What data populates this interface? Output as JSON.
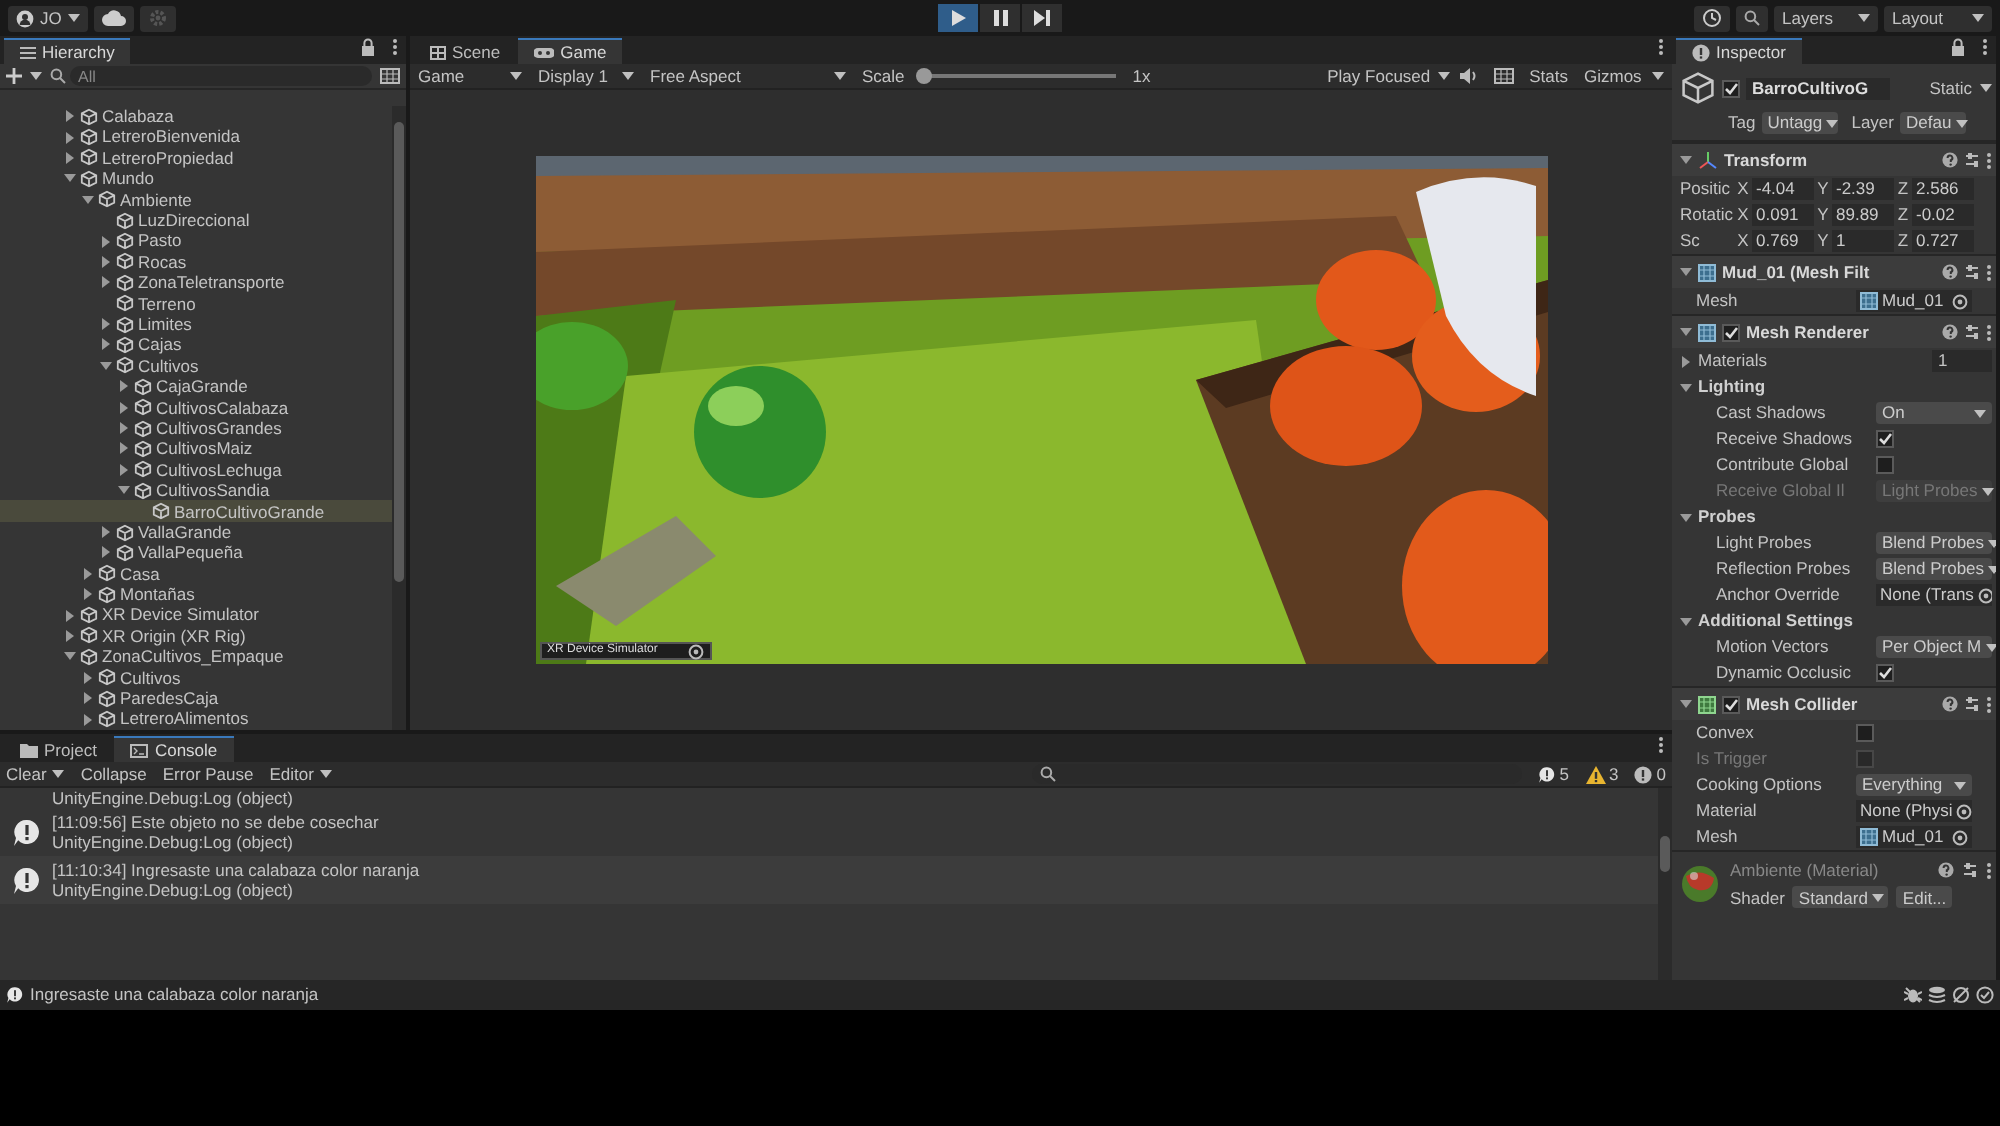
{
  "toolbar": {
    "account": "JO",
    "playing": true,
    "layers": "Layers",
    "layout": "Layout"
  },
  "hierarchy": {
    "title": "Hierarchy",
    "search": {
      "placeholder": "All"
    },
    "items": [
      {
        "label": "Calabaza",
        "expanded": false,
        "selected": false
      },
      {
        "label": "LetreroBienvenida",
        "expanded": false,
        "selected": false
      },
      {
        "label": "LetreroPropiedad",
        "expanded": false,
        "selected": false
      },
      {
        "label": "Mundo",
        "expanded": true,
        "selected": false,
        "children": [
          {
            "label": "Ambiente",
            "expanded": true,
            "selected": false,
            "children": [
              {
                "label": "LuzDireccional",
                "selected": false
              },
              {
                "label": "Pasto",
                "expanded": false,
                "selected": false
              },
              {
                "label": "Rocas",
                "expanded": false,
                "selected": false
              },
              {
                "label": "ZonaTeletransporte",
                "expanded": false,
                "selected": false
              },
              {
                "label": "Terreno",
                "selected": false
              },
              {
                "label": "Limites",
                "expanded": false,
                "selected": false
              },
              {
                "label": "Cajas",
                "expanded": false,
                "selected": false
              },
              {
                "label": "Cultivos",
                "expanded": true,
                "selected": false,
                "children": [
                  {
                    "label": "CajaGrande",
                    "expanded": false,
                    "selected": false
                  },
                  {
                    "label": "CultivosCalabaza",
                    "expanded": false,
                    "selected": false
                  },
                  {
                    "label": "CultivosGrandes",
                    "expanded": false,
                    "selected": false
                  },
                  {
                    "label": "CultivosMaiz",
                    "expanded": false,
                    "selected": false
                  },
                  {
                    "label": "CultivosLechuga",
                    "expanded": false,
                    "selected": false
                  },
                  {
                    "label": "CultivosSandia",
                    "expanded": true,
                    "selected": false,
                    "children": [
                      {
                        "label": "BarroCultivoGrande",
                        "selected": true
                      }
                    ]
                  }
                ]
              },
              {
                "label": "VallaGrande",
                "expanded": false,
                "selected": false
              },
              {
                "label": "VallaPequeña",
                "expanded": false,
                "selected": false
              }
            ]
          },
          {
            "label": "Casa",
            "expanded": false,
            "selected": false
          },
          {
            "label": "Montañas",
            "expanded": false,
            "selected": false
          }
        ]
      },
      {
        "label": "XR Device Simulator",
        "expanded": false,
        "selected": false
      },
      {
        "label": "XR Origin (XR Rig)",
        "expanded": false,
        "selected": false
      },
      {
        "label": "ZonaCultivos_Empaque",
        "expanded": true,
        "selected": false,
        "children": [
          {
            "label": "Cultivos",
            "expanded": false,
            "selected": false
          },
          {
            "label": "ParedesCaja",
            "expanded": false,
            "selected": false
          },
          {
            "label": "LetreroAlimentos",
            "expanded": false,
            "selected": false
          }
        ]
      }
    ]
  },
  "game_view": {
    "tabs": [
      {
        "label": "Scene",
        "kind": "scene",
        "selected": false
      },
      {
        "label": "Game",
        "kind": "game",
        "selected": true
      }
    ],
    "toolbar": {
      "mode": "Game",
      "display": "Display 1",
      "aspect": "Free Aspect",
      "scale_label": "Scale",
      "scale": {
        "level": 0
      },
      "scale_value": "1x",
      "play_mode": "Play Focused",
      "stats": "Stats",
      "gizmos": "Gizmos"
    },
    "overlay": "XR Device Simulator"
  },
  "inspector": {
    "title": "Inspector",
    "object": {
      "name": "BarroCultivoG",
      "active": true,
      "static": "Static",
      "tag_label": "Tag",
      "tag": "Untagg",
      "layer_label": "Layer",
      "layer": "Defau"
    },
    "components": [
      {
        "kind": "transform",
        "title": "Transform",
        "rows": [
          {
            "kind": "vector",
            "label": "Positic",
            "values": [
              {
                "axis": "X",
                "value": "-4.04"
              },
              {
                "axis": "Y",
                "value": "-2.39"
              },
              {
                "axis": "Z",
                "value": "2.586"
              }
            ]
          },
          {
            "kind": "vector",
            "label": "Rotatic",
            "values": [
              {
                "axis": "X",
                "value": "0.091"
              },
              {
                "axis": "Y",
                "value": "89.89"
              },
              {
                "axis": "Z",
                "value": "-0.02"
              }
            ]
          },
          {
            "kind": "vector",
            "label": "Sc",
            "values": [
              {
                "axis": "X",
                "value": "0.769"
              },
              {
                "axis": "Y",
                "value": "1"
              },
              {
                "axis": "Z",
                "value": "0.727"
              }
            ]
          }
        ]
      },
      {
        "kind": "mesh",
        "title": "Mud_01 (Mesh Filt",
        "rows": [
          {
            "kind": "mesh",
            "label": "Mesh",
            "value": "Mud_01",
            "disabled": false
          }
        ]
      },
      {
        "kind": "mesh",
        "title": "Mesh Renderer",
        "enabled": true,
        "rows": [
          {
            "kind": "count",
            "label": "Materials",
            "value": "1",
            "disabled": false
          },
          {
            "kind": "section",
            "label": "Lighting",
            "expanded": true,
            "children": [
              {
                "kind": "dropdown",
                "label": "Cast Shadows",
                "value": "On",
                "disabled": false
              },
              {
                "kind": "check",
                "label": "Receive Shadows",
                "checked": true,
                "disabled": false
              },
              {
                "kind": "check",
                "label": "Contribute Global",
                "checked": false,
                "disabled": false
              },
              {
                "kind": "dropdown",
                "label": "Receive Global Il",
                "value": "Light Probes",
                "disabled": true
              }
            ]
          },
          {
            "kind": "section",
            "label": "Probes",
            "expanded": true,
            "children": [
              {
                "kind": "dropdown",
                "label": "Light Probes",
                "value": "Blend Probes",
                "disabled": false
              },
              {
                "kind": "dropdown",
                "label": "Reflection Probes",
                "value": "Blend Probes",
                "disabled": false
              },
              {
                "kind": "object",
                "label": "Anchor Override",
                "value": "None (Trans",
                "disabled": false
              }
            ]
          },
          {
            "kind": "section",
            "label": "Additional Settings",
            "expanded": true,
            "children": [
              {
                "kind": "dropdown",
                "label": "Motion Vectors",
                "value": "Per Object M",
                "disabled": false
              },
              {
                "kind": "check",
                "label": "Dynamic Occlusic",
                "checked": true,
                "disabled": false
              }
            ]
          }
        ]
      },
      {
        "kind": "collider",
        "title": "Mesh Collider",
        "enabled": true,
        "rows": [
          {
            "kind": "check",
            "label": "Convex",
            "checked": false,
            "disabled": false
          },
          {
            "kind": "check",
            "label": "Is Trigger",
            "checked": false,
            "disabled": true
          },
          {
            "kind": "dropdown",
            "label": "Cooking Options",
            "value": "Everything",
            "disabled": false
          },
          {
            "kind": "object",
            "label": "Material",
            "value": "None (Physi",
            "disabled": false
          },
          {
            "kind": "mesh",
            "label": "Mesh",
            "value": "Mud_01",
            "disabled": false
          }
        ]
      }
    ],
    "material": {
      "name": "Ambiente (Material)",
      "shader_label": "Shader",
      "shader": "Standard",
      "edit": "Edit..."
    }
  },
  "console": {
    "tabs": [
      {
        "label": "Project",
        "kind": "project",
        "selected": false
      },
      {
        "label": "Console",
        "kind": "console",
        "selected": true
      }
    ],
    "buttons": [
      {
        "label": "Clear",
        "dropdown": true
      },
      {
        "label": "Collapse",
        "dropdown": false
      },
      {
        "label": "Error Pause",
        "dropdown": false
      },
      {
        "label": "Editor",
        "dropdown": true
      }
    ],
    "counts": [
      {
        "kind": "info",
        "count": "5"
      },
      {
        "kind": "warning",
        "count": "3"
      },
      {
        "kind": "error",
        "count": "0"
      }
    ],
    "entries": [
      {
        "kind": "partial",
        "detail": "UnityEngine.Debug:Log (object)"
      },
      {
        "kind": "log",
        "message": "[11:09:56] Este objeto no se debe cosechar",
        "detail": "UnityEngine.Debug:Log (object)"
      },
      {
        "kind": "log",
        "message": "[11:10:34] Ingresaste una calabaza color naranja",
        "detail": "UnityEngine.Debug:Log (object)"
      }
    ]
  },
  "status_bar": {
    "message": "Ingresaste una calabaza color naranja"
  }
}
